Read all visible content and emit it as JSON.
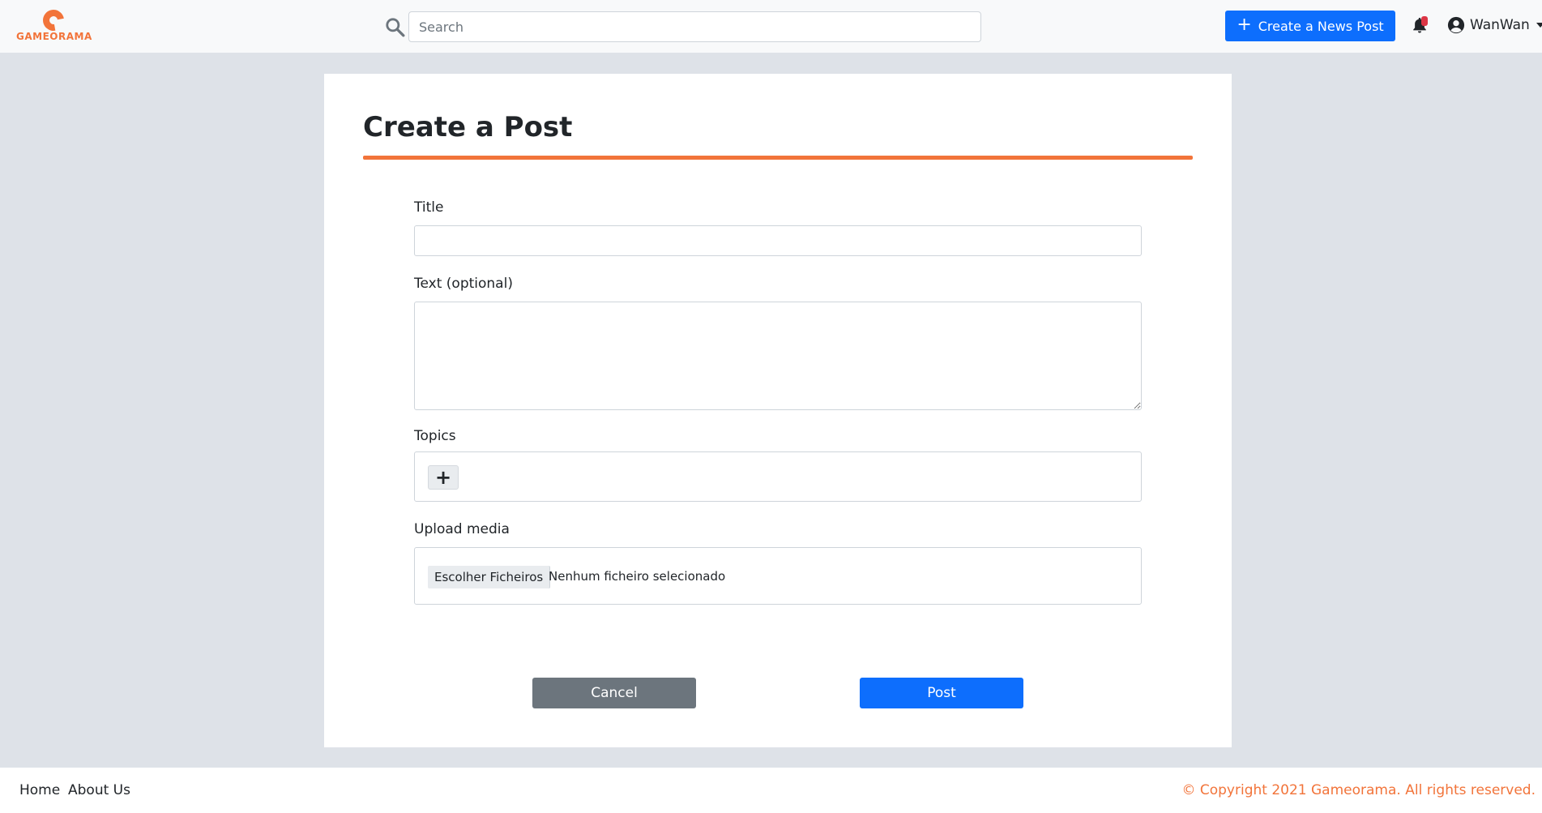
{
  "brand": {
    "name": "GAMEORAMA",
    "accent_color": "#f2743a"
  },
  "header": {
    "search_placeholder": "Search",
    "search_icon": "search-icon",
    "create_news_label": "Create a News Post",
    "notifications_icon": "bell-icon",
    "user_icon": "user-circle-icon",
    "username": "WanWan"
  },
  "form": {
    "page_title": "Create a Post",
    "title_label": "Title",
    "title_value": "",
    "text_label": "Text (optional)",
    "text_value": "",
    "topics_label": "Topics",
    "topics_add_label": "+",
    "upload_label": "Upload media",
    "choose_files_label": "Escolher Ficheiros",
    "no_file_text": "Nenhum ficheiro selecionado",
    "cancel_label": "Cancel",
    "post_label": "Post"
  },
  "footer": {
    "links": [
      "Home",
      "About Us"
    ],
    "copyright": "© Copyright 2021 Gameorama. All rights reserved."
  },
  "colors": {
    "primary": "#0d6efd",
    "secondary": "#6c757d",
    "background": "#dee2e8"
  }
}
